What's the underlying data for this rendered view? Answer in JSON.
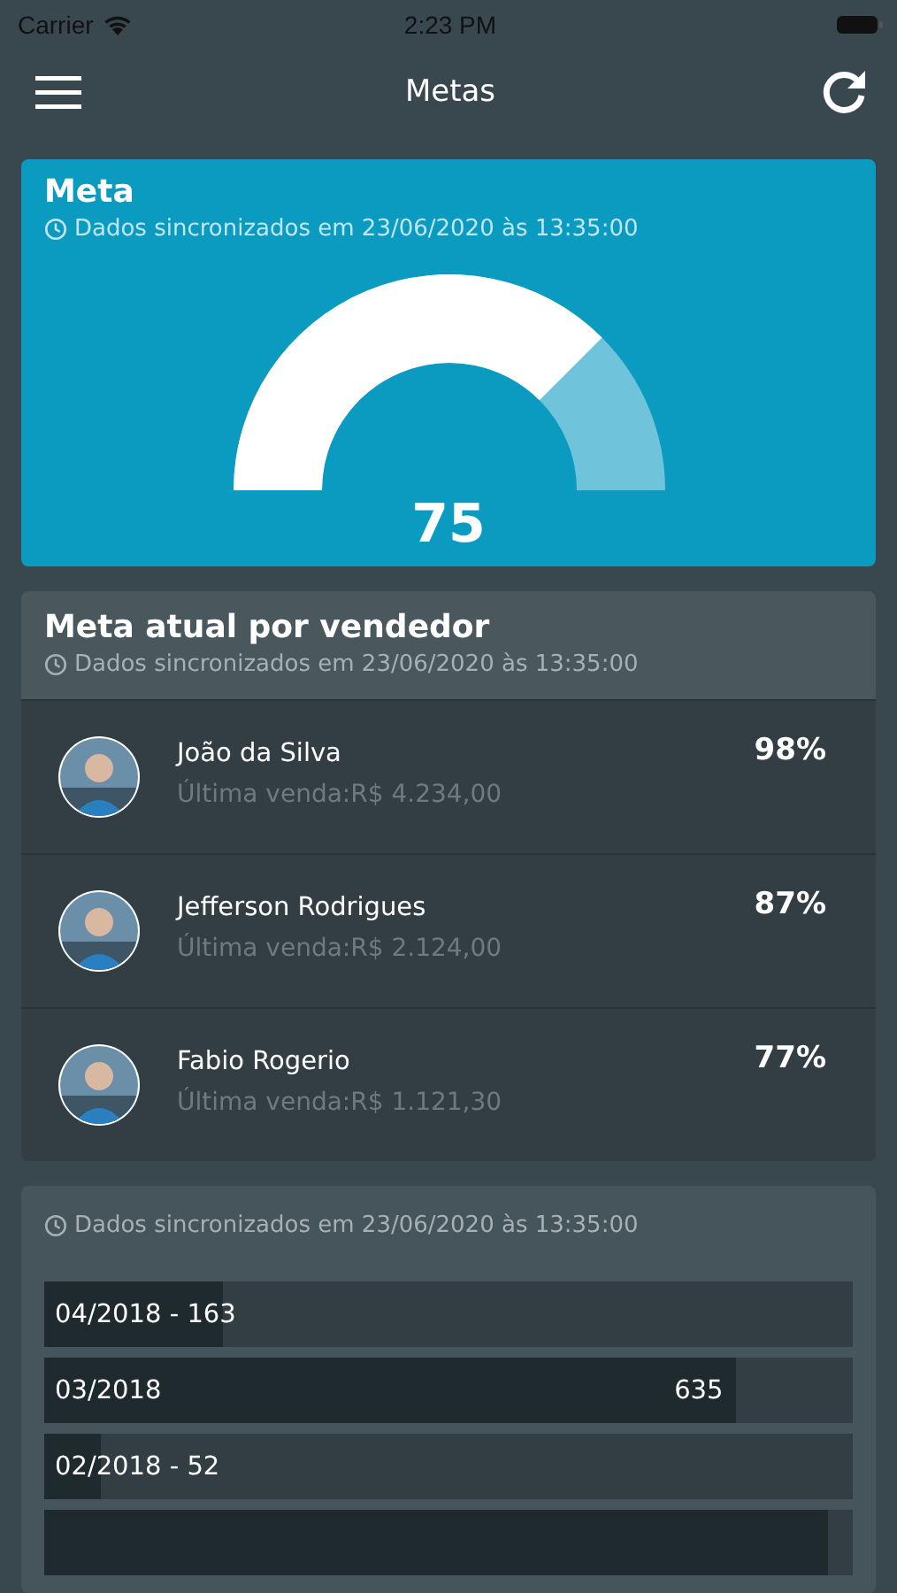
{
  "status_bar": {
    "carrier": "Carrier",
    "time": "2:23 PM"
  },
  "nav": {
    "title": "Metas"
  },
  "meta_card": {
    "title": "Meta",
    "sync": "Dados sincronizados em 23/06/2020 às 13:35:00",
    "value": "75"
  },
  "vendor_card": {
    "title": "Meta atual por vendedor",
    "sync": "Dados sincronizados em 23/06/2020 às 13:35:00",
    "sellers": [
      {
        "name": "João da Silva",
        "last_sale": "Última venda:R$ 4.234,00",
        "percent": "98%"
      },
      {
        "name": "Jefferson Rodrigues",
        "last_sale": "Última venda:R$ 2.124,00",
        "percent": "87%"
      },
      {
        "name": "Fabio Rogerio",
        "last_sale": "Última venda:R$ 1.121,30",
        "percent": "77%"
      }
    ]
  },
  "history_card": {
    "sync": "Dados sincronizados em 23/06/2020 às 13:35:00",
    "bars": [
      {
        "label": "04/2018 - 163",
        "level": 0.22
      },
      {
        "label": "03/2018",
        "value": "635",
        "level": 0.855
      },
      {
        "label": "02/2018 - 52",
        "level": 0.07
      },
      {
        "level": 0.97
      }
    ]
  }
}
